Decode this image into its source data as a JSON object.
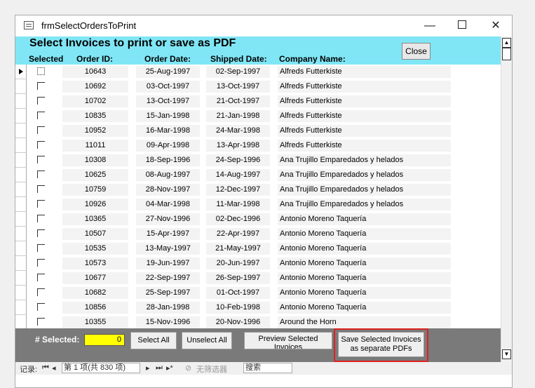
{
  "window": {
    "title": "frmSelectOrdersToPrint"
  },
  "header": {
    "title": "Select Invoices to print or save as PDF",
    "col_selected": "Selected",
    "col_order_id": "Order ID:",
    "col_order_date": "Order Date:",
    "col_shipped_date": "Shipped Date:",
    "col_company": "Company Name:",
    "close_label": "Close"
  },
  "rows": [
    {
      "id": "10643",
      "order_date": "25-Aug-1997",
      "shipped": "02-Sep-1997",
      "company": "Alfreds Futterkiste"
    },
    {
      "id": "10692",
      "order_date": "03-Oct-1997",
      "shipped": "13-Oct-1997",
      "company": "Alfreds Futterkiste"
    },
    {
      "id": "10702",
      "order_date": "13-Oct-1997",
      "shipped": "21-Oct-1997",
      "company": "Alfreds Futterkiste"
    },
    {
      "id": "10835",
      "order_date": "15-Jan-1998",
      "shipped": "21-Jan-1998",
      "company": "Alfreds Futterkiste"
    },
    {
      "id": "10952",
      "order_date": "16-Mar-1998",
      "shipped": "24-Mar-1998",
      "company": "Alfreds Futterkiste"
    },
    {
      "id": "11011",
      "order_date": "09-Apr-1998",
      "shipped": "13-Apr-1998",
      "company": "Alfreds Futterkiste"
    },
    {
      "id": "10308",
      "order_date": "18-Sep-1996",
      "shipped": "24-Sep-1996",
      "company": "Ana Trujillo Emparedados y helados"
    },
    {
      "id": "10625",
      "order_date": "08-Aug-1997",
      "shipped": "14-Aug-1997",
      "company": "Ana Trujillo Emparedados y helados"
    },
    {
      "id": "10759",
      "order_date": "28-Nov-1997",
      "shipped": "12-Dec-1997",
      "company": "Ana Trujillo Emparedados y helados"
    },
    {
      "id": "10926",
      "order_date": "04-Mar-1998",
      "shipped": "11-Mar-1998",
      "company": "Ana Trujillo Emparedados y helados"
    },
    {
      "id": "10365",
      "order_date": "27-Nov-1996",
      "shipped": "02-Dec-1996",
      "company": "Antonio Moreno Taquería"
    },
    {
      "id": "10507",
      "order_date": "15-Apr-1997",
      "shipped": "22-Apr-1997",
      "company": "Antonio Moreno Taquería"
    },
    {
      "id": "10535",
      "order_date": "13-May-1997",
      "shipped": "21-May-1997",
      "company": "Antonio Moreno Taquería"
    },
    {
      "id": "10573",
      "order_date": "19-Jun-1997",
      "shipped": "20-Jun-1997",
      "company": "Antonio Moreno Taquería"
    },
    {
      "id": "10677",
      "order_date": "22-Sep-1997",
      "shipped": "26-Sep-1997",
      "company": "Antonio Moreno Taquería"
    },
    {
      "id": "10682",
      "order_date": "25-Sep-1997",
      "shipped": "01-Oct-1997",
      "company": "Antonio Moreno Taquería"
    },
    {
      "id": "10856",
      "order_date": "28-Jan-1998",
      "shipped": "10-Feb-1998",
      "company": "Antonio Moreno Taquería"
    },
    {
      "id": "10355",
      "order_date": "15-Nov-1996",
      "shipped": "20-Nov-1996",
      "company": "Around the Horn"
    }
  ],
  "footer": {
    "selected_label": "# Selected:",
    "selected_count": "0",
    "select_all": "Select All",
    "unselect_all": "Unselect All",
    "preview_line1": "Preview Selected",
    "preview_line2": "Invoices",
    "save_line1": "Save Selected Invoices",
    "save_line2": "as separate PDFs"
  },
  "navbar": {
    "record_label": "记录:",
    "position": "第 1 项(共 830 项)",
    "filter": "无筛选器",
    "search": "搜索"
  },
  "colors": {
    "header_bg": "#80e6f5",
    "footer_bg": "#7a7a7a",
    "count_bg": "#ffff00",
    "highlight": "#e02020"
  }
}
